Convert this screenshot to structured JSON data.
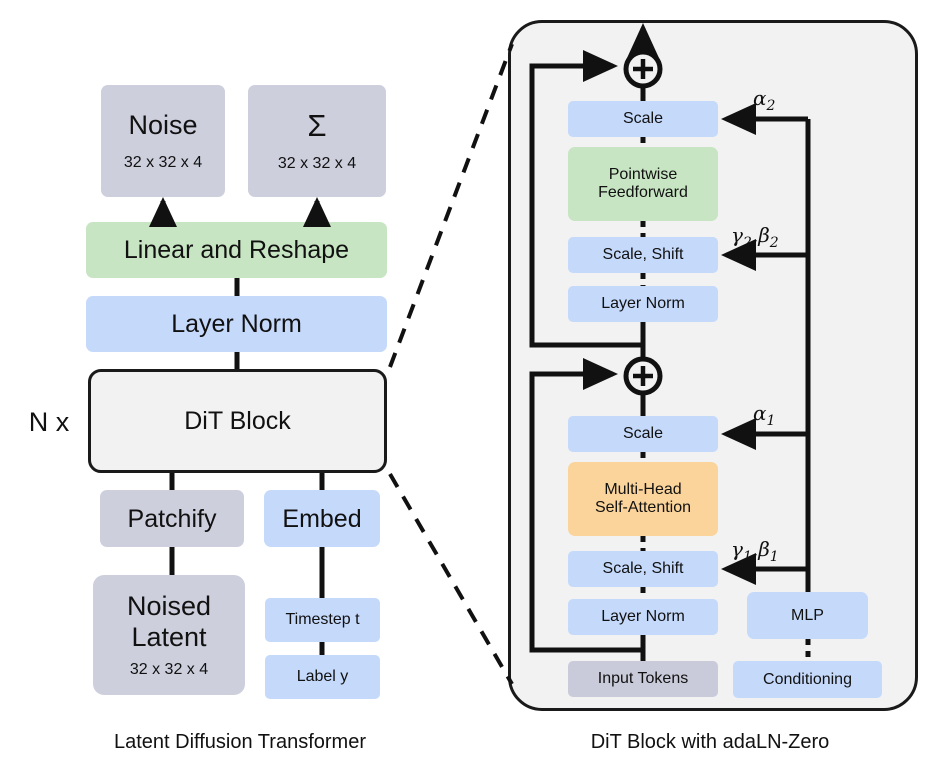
{
  "figure": {
    "left_caption": "Latent Diffusion Transformer",
    "right_caption": "DiT Block with adaLN-Zero"
  },
  "left_panel": {
    "repeat_label": "N x",
    "noise_box": {
      "title": "Noise",
      "shape": "32 x 32 x 4"
    },
    "sigma_box": {
      "title": "Σ",
      "shape": "32 x 32 x 4"
    },
    "linear_reshape": "Linear and Reshape",
    "layer_norm": "Layer Norm",
    "dit_block": "DiT Block",
    "patchify": "Patchify",
    "embed": "Embed",
    "noised_latent": {
      "line1": "Noised",
      "line2": "Latent",
      "shape": "32 x 32 x 4"
    },
    "timestep": "Timestep t",
    "label_y": "Label y"
  },
  "right_panel": {
    "plus_top": "+",
    "plus_bottom": "+",
    "scale_top": "Scale",
    "pointwise_feedforward": {
      "line1": "Pointwise",
      "line2": "Feedforward"
    },
    "scale_shift_top": "Scale, Shift",
    "layer_norm_top": "Layer Norm",
    "scale_bottom": "Scale",
    "multi_head_attention": {
      "line1": "Multi-Head",
      "line2": "Self-Attention"
    },
    "scale_shift_bottom": "Scale, Shift",
    "layer_norm_bottom": "Layer Norm",
    "input_tokens": "Input Tokens",
    "mlp": "MLP",
    "conditioning": "Conditioning",
    "alpha2": {
      "base": "α",
      "sub": "2"
    },
    "gamma_beta2": {
      "g": "γ",
      "gs": "2",
      "sep": ",",
      "b": "β",
      "bs": "2"
    },
    "alpha1": {
      "base": "α",
      "sub": "1"
    },
    "gamma_beta1": {
      "g": "γ",
      "gs": "1",
      "sep": ",",
      "b": "β",
      "bs": "1"
    }
  },
  "colors": {
    "grey": "#cdcfdd",
    "blue": "#c5d9fb",
    "green": "#c7e5c2",
    "orange": "#fbd49b",
    "panel": "#f2f2f2",
    "stroke": "#1a1a1a"
  }
}
